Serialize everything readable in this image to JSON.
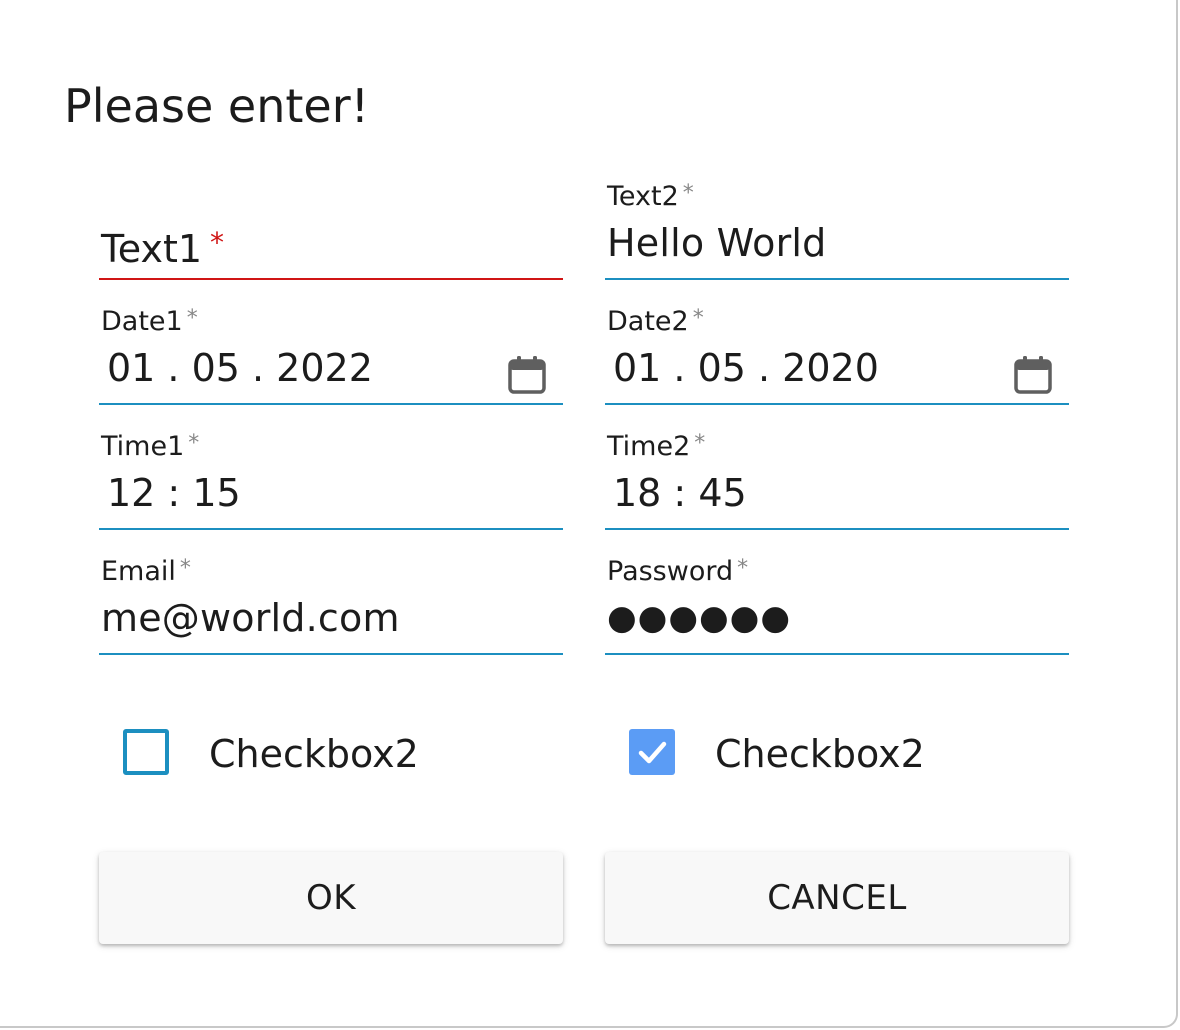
{
  "dialog": {
    "title": "Please enter!"
  },
  "fields": {
    "text1": {
      "label": "Text1",
      "required_mark": "*",
      "value": "",
      "state": "invalid"
    },
    "text2": {
      "label": "Text2",
      "required_mark": "*",
      "value": "Hello World"
    },
    "date1": {
      "label": "Date1",
      "required_mark": "*",
      "value": "01 . 05 . 2022",
      "icon": "calendar-icon"
    },
    "date2": {
      "label": "Date2",
      "required_mark": "*",
      "value": "01 . 05 . 2020",
      "icon": "calendar-icon"
    },
    "time1": {
      "label": "Time1",
      "required_mark": "*",
      "value": "12 : 15"
    },
    "time2": {
      "label": "Time2",
      "required_mark": "*",
      "value": "18 : 45"
    },
    "email": {
      "label": "Email",
      "required_mark": "*",
      "value": "me@world.com"
    },
    "password": {
      "label": "Password",
      "required_mark": "*",
      "value": "●●●●●●"
    }
  },
  "checkboxes": [
    {
      "label": "Checkbox2",
      "checked": false
    },
    {
      "label": "Checkbox2",
      "checked": true
    }
  ],
  "buttons": {
    "ok_label": "OK",
    "cancel_label": "CANCEL"
  },
  "colors": {
    "accent": "#1c8fc0",
    "error": "#d01515",
    "checkbox_checked": "#5b9cf5",
    "button_bg": "#f8f8f8"
  }
}
